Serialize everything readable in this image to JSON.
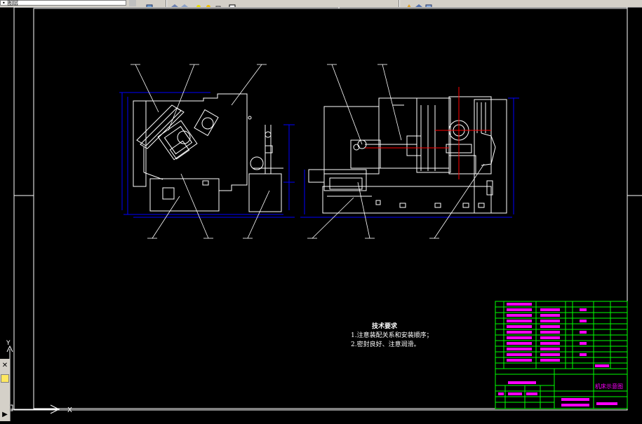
{
  "toolbar": {
    "layer_field": "• 图层",
    "dropdown_arrow": "▾"
  },
  "notes": {
    "title": "技术要求",
    "line1": "1.注意装配关系和安装顺序；",
    "line2": "2.密封良好、注意润滑。"
  },
  "title_block": {
    "drawing_title": "机床示意图",
    "parts_rows": [
      "CJ6232-01",
      "CJ6232-02",
      "CJ6232-03",
      "CJ6232-04",
      "CJ6232-05",
      "标准件",
      "GB5783-84",
      "GB5783-85",
      "GB5782-86",
      "GB5782-87",
      "GB5782-88",
      "GB1096-79"
    ]
  },
  "ucs": {
    "y_label": "Y",
    "x_label": "X"
  },
  "leftbar": {
    "close_icon": "✕",
    "play_icon": "▶"
  },
  "colors": {
    "background": "#000000",
    "drawing_lines": "#ffffff",
    "dimensions": "#0000ff",
    "title_block_grid": "#00ff00",
    "title_text": "#ff00ff",
    "centerline": "#ff0000"
  }
}
